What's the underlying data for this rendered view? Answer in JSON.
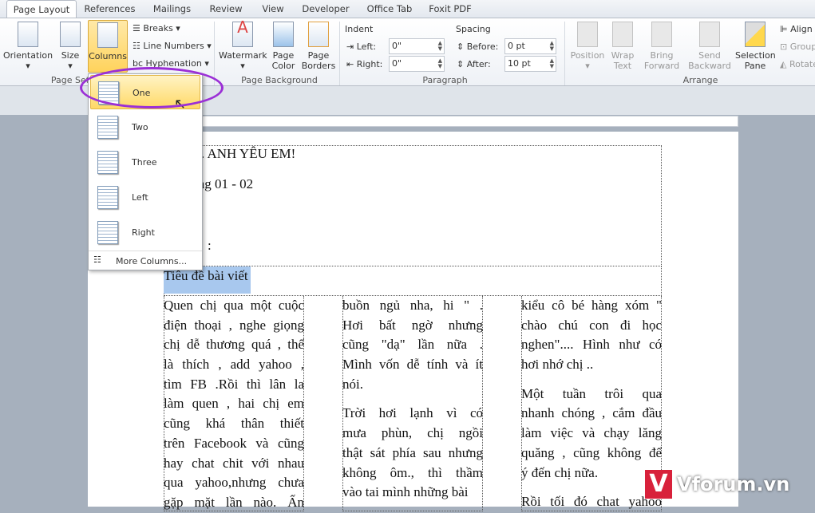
{
  "tabs": [
    "Page Layout",
    "References",
    "Mailings",
    "Review",
    "View",
    "Developer",
    "Office Tab",
    "Foxit PDF"
  ],
  "ribbon": {
    "page_setup": {
      "orientation": "Orientation",
      "size": "Size",
      "columns": "Columns",
      "breaks": "Breaks",
      "line_numbers": "Line Numbers",
      "hyphenation": "Hyphenation",
      "label": "Page Setup"
    },
    "page_background": {
      "watermark": "Watermark",
      "page_color": "Page Color",
      "page_borders": "Page Borders",
      "label": "Page Background"
    },
    "paragraph": {
      "indent": "Indent",
      "left_label": "Left:",
      "left_value": "0\"",
      "right_label": "Right:",
      "right_value": "0\"",
      "spacing": "Spacing",
      "before_label": "Before:",
      "before_value": "0 pt",
      "after_label": "After:",
      "after_value": "10 pt",
      "label": "Paragraph"
    },
    "arrange": {
      "position": "Position",
      "wrap_text": "Wrap Text",
      "bring_forward": "Bring Forward",
      "send_backward": "Send Backward",
      "selection_pane": "Selection Pane",
      "align": "Align",
      "group": "Group",
      "rotate": "Rotate",
      "label": "Arrange"
    }
  },
  "columns_menu": {
    "items": [
      "One",
      "Two",
      "Three",
      "Left",
      "Right"
    ],
    "selected": "One",
    "more": "More Columns..."
  },
  "document": {
    "header_lines": [
      "...I... ANH YÊU EM!",
      "...ng 01 - 02",
      ":"
    ],
    "title": "Tiêu đề bài viết",
    "col1": [
      [
        "Quen chị qua một cuộc",
        "điện thoại , nghe giọng",
        "chị dễ thương quá , thế",
        "là thích , add yahoo ,",
        "tìm FB .Rồi thì lân la",
        "làm quen , hai chị em",
        "cũng khá thân thiết",
        "trên Facebook và cũng",
        "hay chat chit với nhau",
        "qua yahoo,nhưng chưa",
        "gặp mặt lần nào. Ấn"
      ]
    ],
    "col2": [
      [
        "buồn ngủ nha, hi \" .",
        "Hơi bất ngờ nhưng",
        "cũng \"dạ\" lần nữa .",
        "Mình vốn dễ tính và ít",
        "nói."
      ],
      [
        "Trời hơi lạnh vì có",
        "mưa phùn, chị ngồi",
        "thật sát phía sau nhưng",
        "không ôm., thì thầm",
        "vào tai mình những bài"
      ]
    ],
    "col3": [
      [
        "kiểu cô bé hàng xóm \"",
        "chào chú con đi học",
        "nghen\".... Hình như có",
        "hơi nhớ chị .."
      ],
      [
        "Một tuần trôi qua",
        "nhanh chóng , cắm đầu",
        "làm việc và chạy lăng",
        "quăng , cũng không để",
        "ý đến chị nữa."
      ],
      [
        "Rồi tối đó chat yahoo"
      ]
    ]
  },
  "watermark": "Vforum.vn",
  "colors": {
    "highlight": "#ffd966",
    "annotation": "#9b2fd6",
    "selection": "#a8c8ee",
    "brand": "#d8213b"
  }
}
